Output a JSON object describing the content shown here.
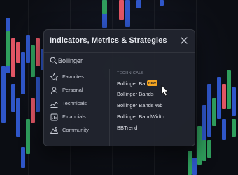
{
  "dialog": {
    "title": "Indicators, Metrics & Strategies"
  },
  "search": {
    "value": "Bollinger",
    "placeholder": "Search"
  },
  "sidebar": {
    "items": [
      {
        "label": "Favorites",
        "icon": "star-icon"
      },
      {
        "label": "Personal",
        "icon": "user-icon"
      },
      {
        "label": "Technicals",
        "icon": "chart-line-icon"
      },
      {
        "label": "Financials",
        "icon": "financials-icon"
      },
      {
        "label": "Community",
        "icon": "community-icon"
      }
    ]
  },
  "results": {
    "section_heading": "TECHNICALS",
    "items": [
      {
        "label": "Bollinger Bars",
        "badge": "NEW"
      },
      {
        "label": "Bollinger Bands"
      },
      {
        "label": "Bollinger Bands %b"
      },
      {
        "label": "Bollinger BandWidth"
      },
      {
        "label": "BBTrend"
      }
    ]
  },
  "colors": {
    "up": "#2f9e5c",
    "down": "#e05564",
    "neutral": "#2f56c8",
    "badge": "#f5a623",
    "modal_bg": "#21242e"
  }
}
